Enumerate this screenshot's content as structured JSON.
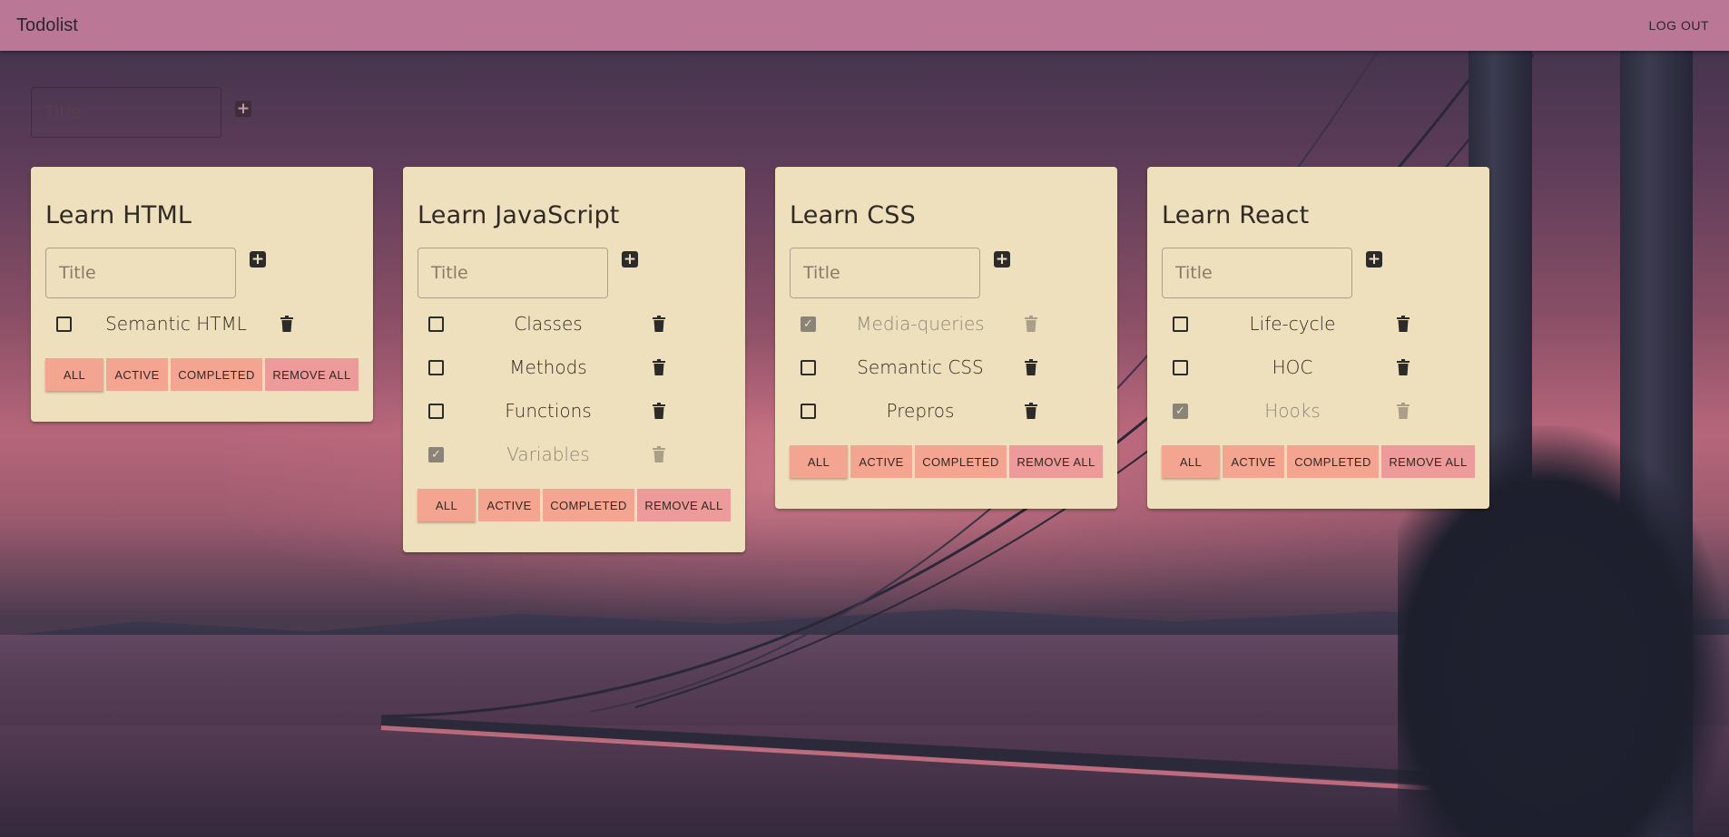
{
  "app": {
    "title": "Todolist",
    "logout_label": "LOG OUT"
  },
  "new_list": {
    "placeholder": "Title",
    "add_icon": "plus-square-icon"
  },
  "filters": {
    "all": "ALL",
    "active": "ACTIVE",
    "completed": "COMPLETED",
    "remove_all": "REMOVE ALL"
  },
  "lists": [
    {
      "title": "Learn HTML",
      "placeholder": "Title",
      "tasks": [
        {
          "title": "Semantic HTML",
          "done": false
        }
      ]
    },
    {
      "title": "Learn JavaScript",
      "placeholder": "Title",
      "tasks": [
        {
          "title": "Classes",
          "done": false
        },
        {
          "title": "Methods",
          "done": false
        },
        {
          "title": "Functions",
          "done": false
        },
        {
          "title": "Variables",
          "done": true
        }
      ]
    },
    {
      "title": "Learn CSS",
      "placeholder": "Title",
      "tasks": [
        {
          "title": "Media-queries",
          "done": true
        },
        {
          "title": "Semantic CSS",
          "done": false
        },
        {
          "title": "Prepros",
          "done": false
        }
      ]
    },
    {
      "title": "Learn React",
      "placeholder": "Title",
      "tasks": [
        {
          "title": "Life-cycle",
          "done": false
        },
        {
          "title": "HOC",
          "done": false
        },
        {
          "title": "Hooks",
          "done": true
        }
      ]
    }
  ],
  "colors": {
    "appbar": "#bb7896",
    "card": "#efe0bd",
    "filter_button": "#f4a591",
    "remove_button": "#ec9a9a"
  }
}
